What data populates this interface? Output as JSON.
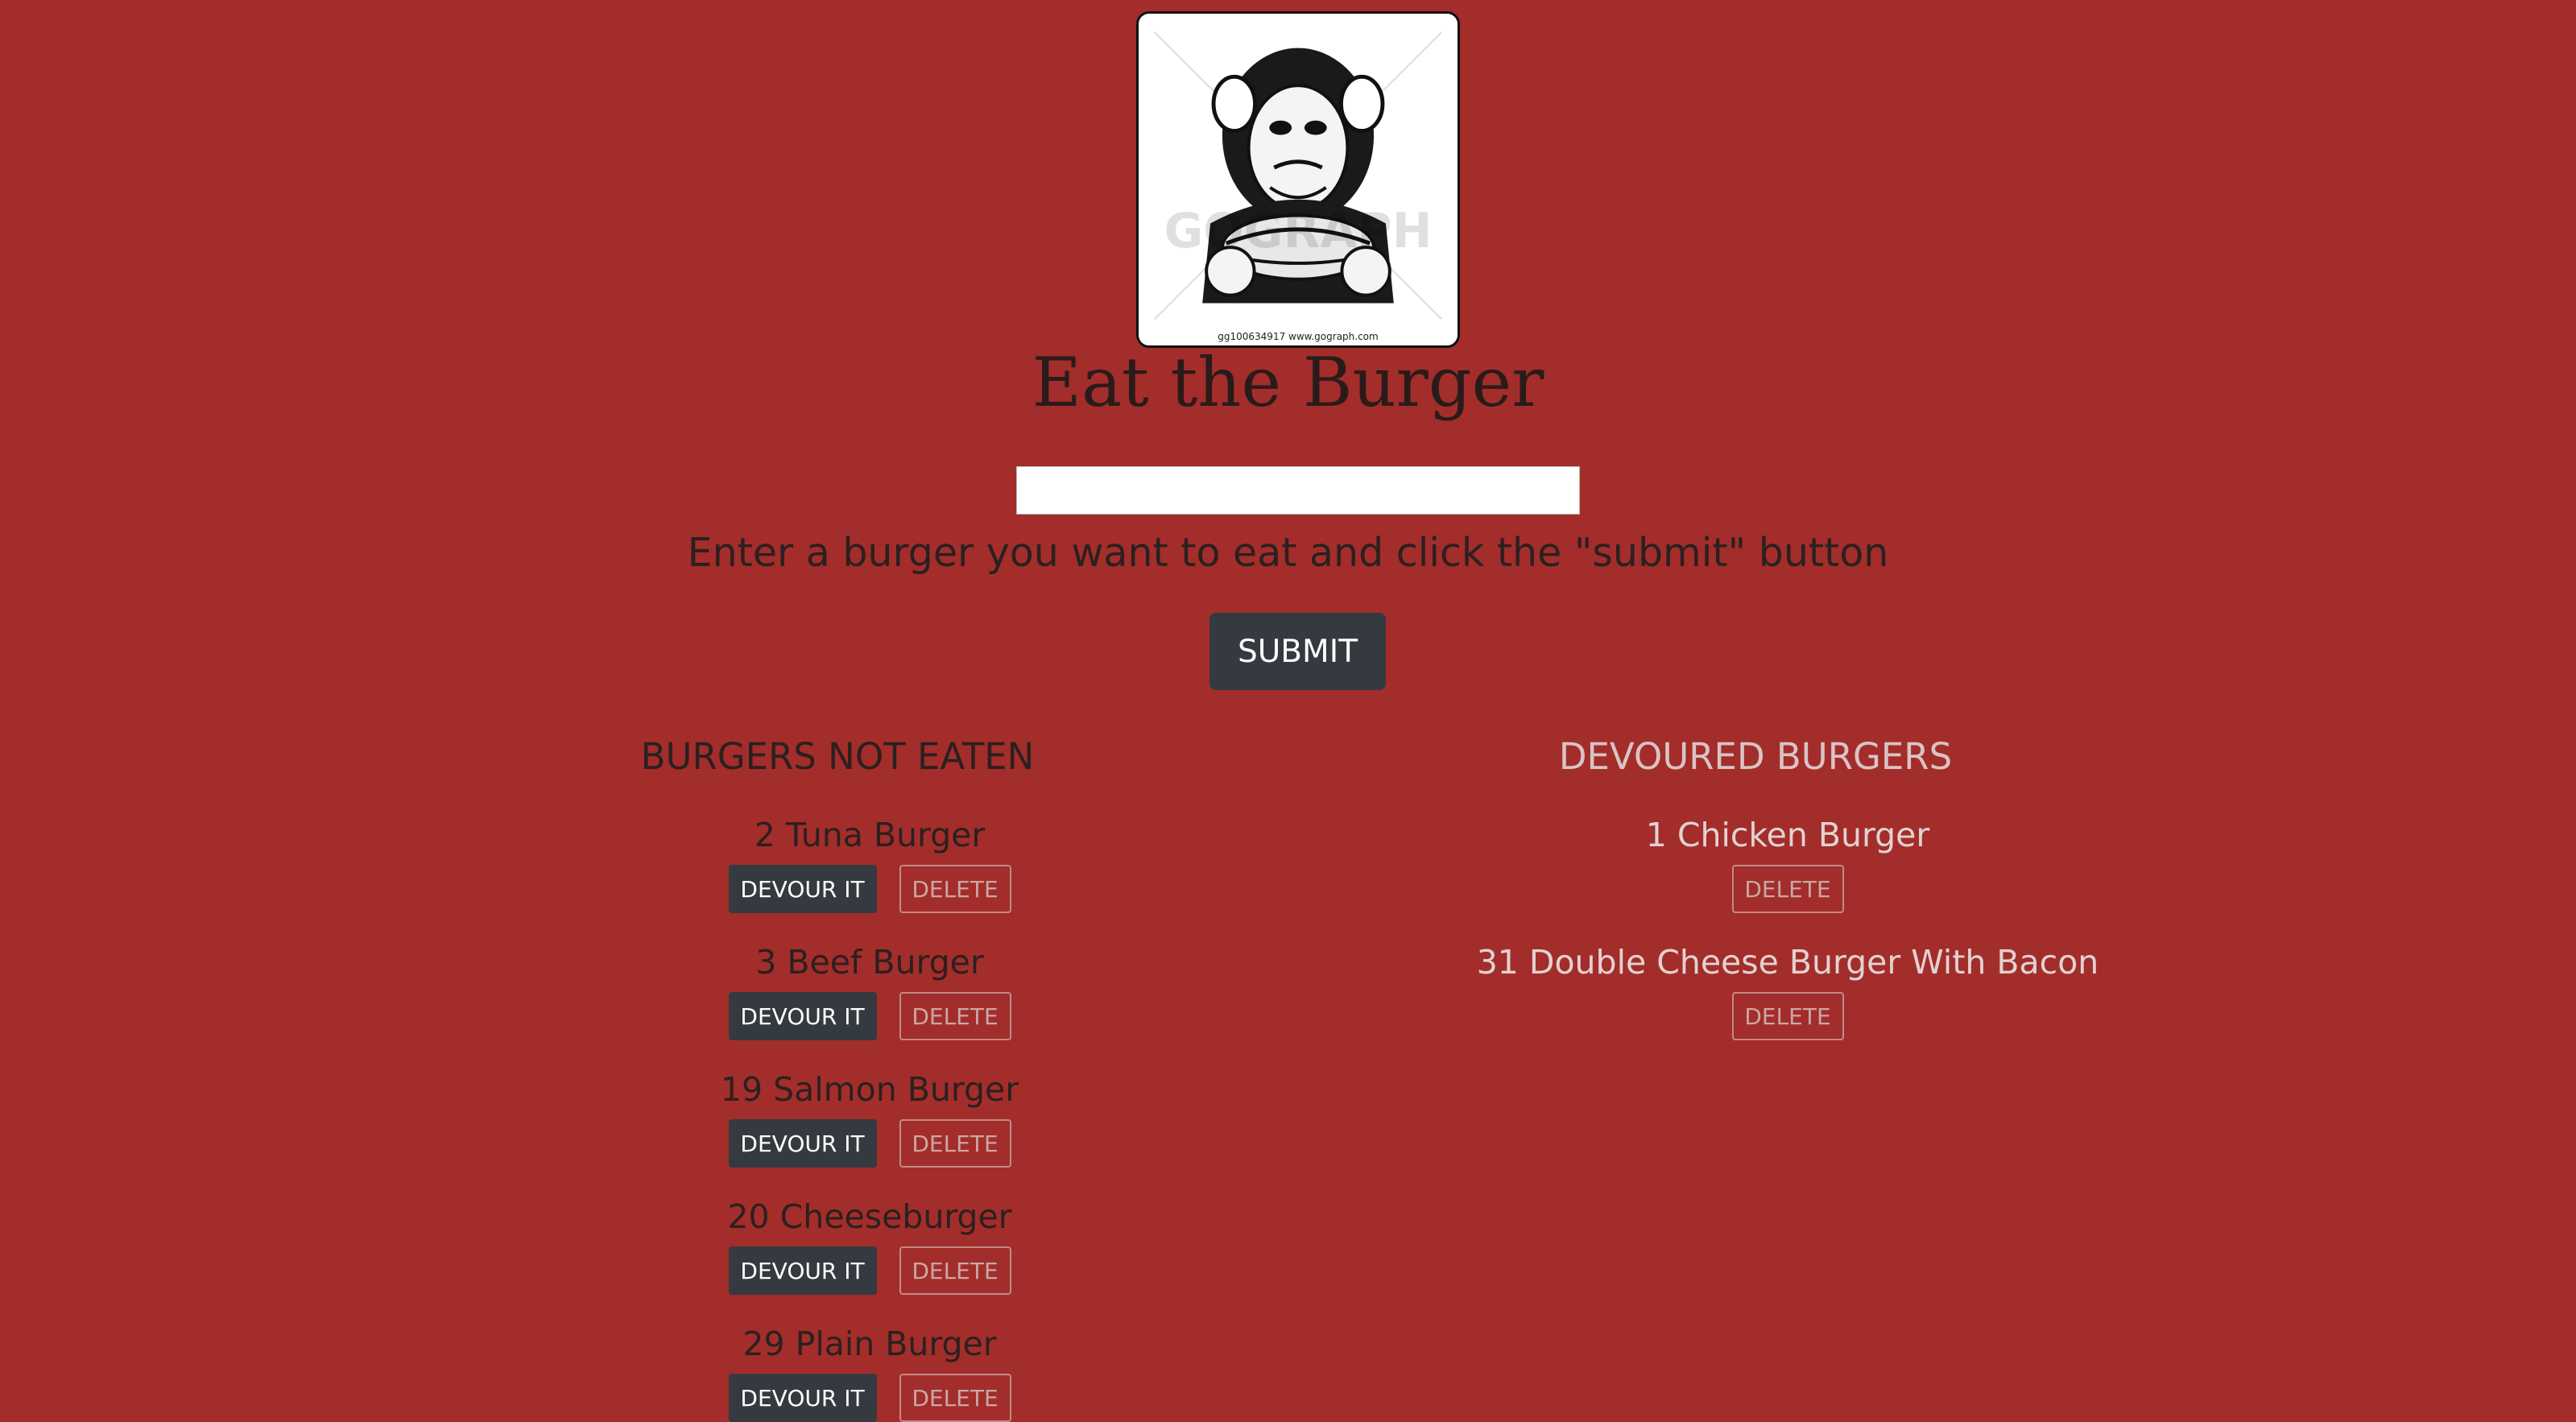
{
  "header": {
    "logo_caption": "gg100634917 www.gograph.com",
    "title": "Eat the Burger"
  },
  "form": {
    "input_value": "",
    "instructions": "Enter a burger you want to eat and click the \"submit\" button",
    "submit_label": "SUBMIT"
  },
  "not_eaten": {
    "heading": "BURGERS NOT EATEN",
    "devour_label": "DEVOUR IT",
    "delete_label": "DELETE",
    "items": [
      {
        "name": "2 Tuna Burger"
      },
      {
        "name": "3 Beef Burger"
      },
      {
        "name": "19 Salmon Burger"
      },
      {
        "name": "20 Cheeseburger"
      },
      {
        "name": "29 Plain Burger"
      }
    ]
  },
  "devoured": {
    "heading": "DEVOURED BURGERS",
    "delete_label": "DELETE",
    "items": [
      {
        "name": "1 Chicken Burger"
      },
      {
        "name": "31 Double Cheese Burger With Bacon"
      }
    ]
  }
}
